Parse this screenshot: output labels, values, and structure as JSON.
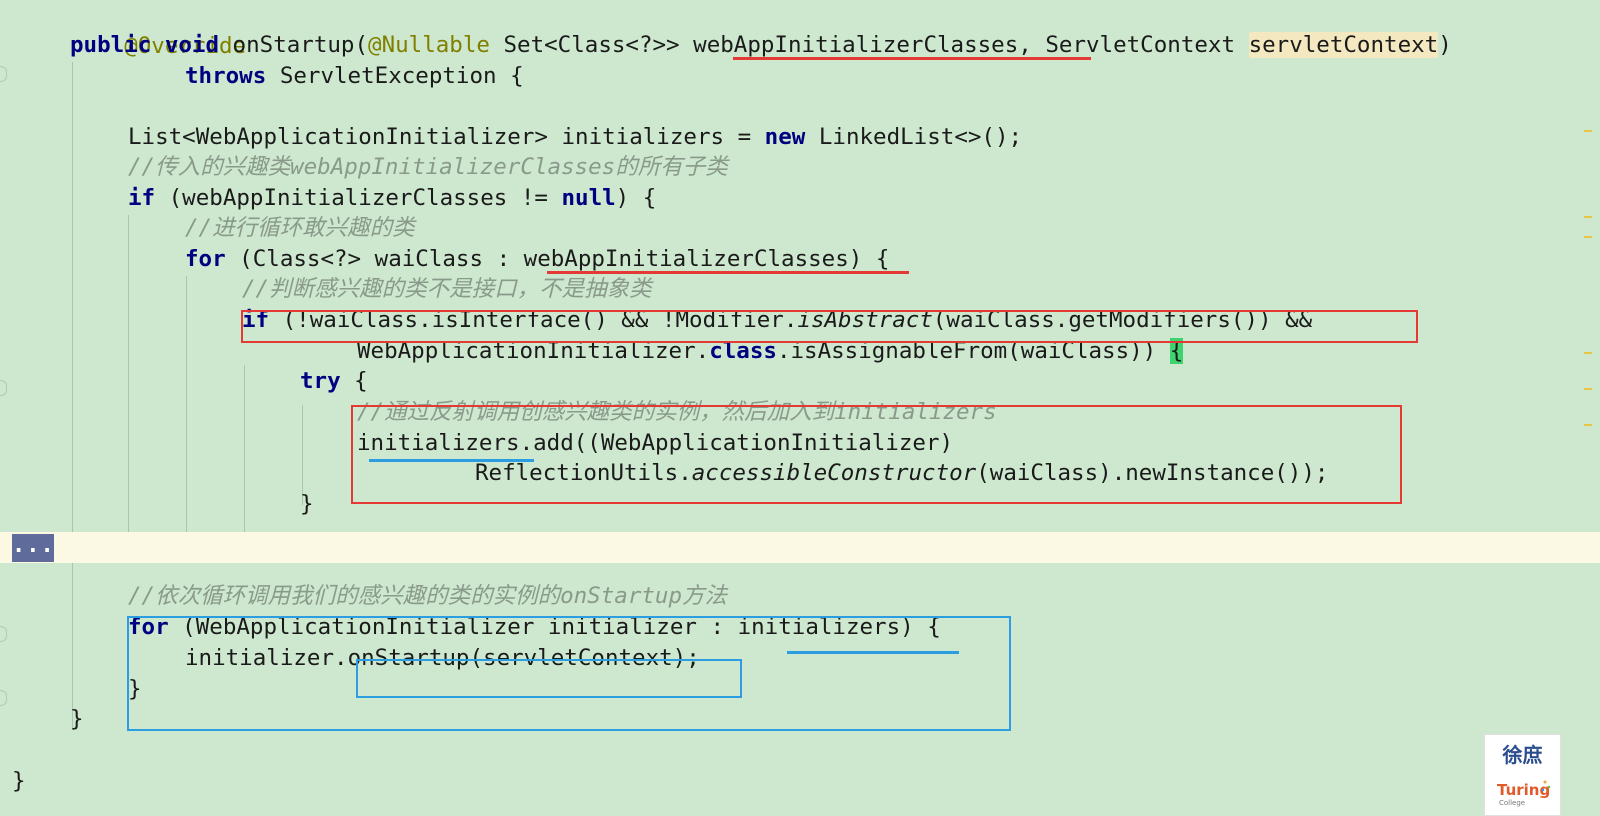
{
  "editor": {
    "lines": {
      "l1": {
        "annotation": "@Override"
      },
      "l2": {
        "kw_public": "public",
        "kw_void": "void",
        "method": " onStartup(",
        "nullable": "@Nullable",
        "set_type": " Set<Class<?>> ",
        "param1": "webAppInitializerClasses",
        "sep": ", ServletContext ",
        "param2": "servletContext",
        "close": ")"
      },
      "l3": {
        "kw_throws": "throws",
        "rest": " ServletException {"
      },
      "l5": {
        "type": "List<WebApplicationInitializer> initializers = ",
        "kw_new": "new",
        "rest": " LinkedList<>();"
      },
      "l6": {
        "comment": "//传入的兴趣类webAppInitializerClasses的所有子类"
      },
      "l7": {
        "kw_if": "if",
        "mid": " (webAppInitializerClasses != ",
        "kw_null": "null",
        "rest": ") {"
      },
      "l8": {
        "comment": "//进行循环敢兴趣的类"
      },
      "l9": {
        "kw_for": "for",
        "mid": " (Class<?> waiClass : ",
        "coll": "webAppInitializerClasses",
        "rest": ") {"
      },
      "l10": {
        "comment": "//判断感兴趣的类不是接口，不是抽象类"
      },
      "l11": {
        "kw_if": "if",
        "a": " (!waiClass.isInterface() && !Modifier.",
        "italic": "isAbstract",
        "b": "(waiClass.getModifiers()) &&"
      },
      "l12": {
        "a": "WebApplicationInitializer.",
        "kw_class": "class",
        "b": ".isAssignableFrom(waiClass)) ",
        "brace": "{"
      },
      "l13": {
        "kw_try": "try",
        "rest": " {"
      },
      "l14": {
        "comment": "//通过反射调用创感兴趣类的实例，然后加入到initializers"
      },
      "l15": {
        "var": "initializers",
        "rest": ".add((WebApplicationInitializer)"
      },
      "l16": {
        "a": "ReflectionUtils.",
        "italic": "accessibleConstructor",
        "b": "(waiClass).newInstance());"
      },
      "l17": {
        "text": "}"
      },
      "l18": {
        "fold": "..."
      },
      "l20": {
        "comment": "//依次循环调用我们的感兴趣的类的实例的onStartup方法"
      },
      "l21": {
        "kw_for": "for",
        "mid": " (WebApplicationInitializer initializer : ",
        "coll": "initializers",
        "rest": ") {"
      },
      "l22": {
        "a": "initializer.",
        "call": "onStartup(servletContext);"
      },
      "l23": {
        "text": "}"
      },
      "l24": {
        "text": "}"
      },
      "l26": {
        "text": "}"
      }
    }
  },
  "watermark": {
    "title_cn": "徐庶",
    "brand": "Turing",
    "sub": "College"
  },
  "colors": {
    "background": "#cde8cf",
    "keyword": "#000080",
    "annotation": "#808000",
    "comment": "#8a9a8a",
    "highlight_red": "#e53935",
    "highlight_blue": "#2b9de0"
  }
}
